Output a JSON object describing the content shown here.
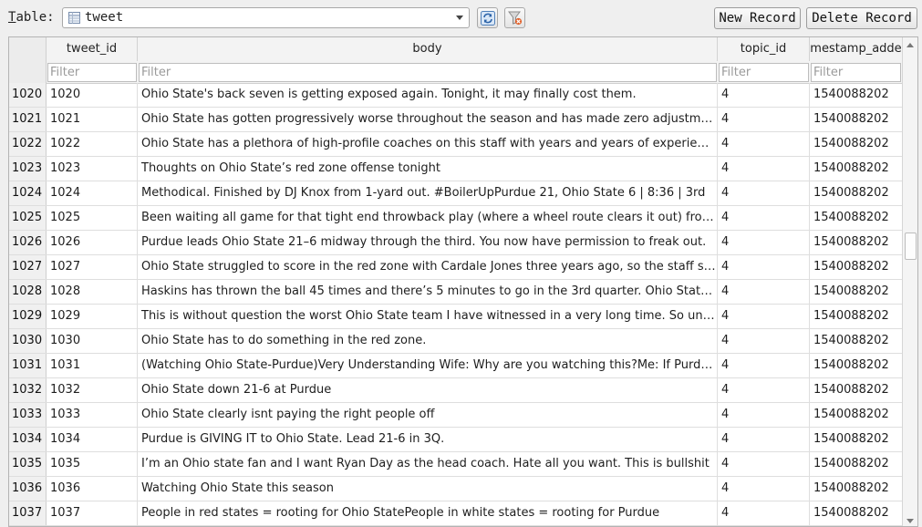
{
  "toolbar": {
    "table_label_prefix": "T",
    "table_label_rest": "able:",
    "table_name": "tweet",
    "table_icon": "table-icon",
    "refresh_icon": "refresh-icon",
    "clear_filter_icon": "clear-filter-icon",
    "new_record_label": "New Record",
    "delete_record_label": "Delete Record"
  },
  "grid": {
    "columns": [
      "tweet_id",
      "body",
      "topic_id",
      "mestamp_adde"
    ],
    "filter_placeholder": "Filter",
    "rows": [
      {
        "rownum": "1020",
        "tweet_id": "1020",
        "body": "Ohio State's back seven is getting exposed again. Tonight, it may finally cost them.",
        "topic_id": "4",
        "timestamp": "1540088202"
      },
      {
        "rownum": "1021",
        "tweet_id": "1021",
        "body": "Ohio State has gotten progressively worse throughout the season and has made zero adjustm…",
        "topic_id": "4",
        "timestamp": "1540088202"
      },
      {
        "rownum": "1022",
        "tweet_id": "1022",
        "body": "Ohio State has a plethora of high-profile coaches on this staff with years and years of experie…",
        "topic_id": "4",
        "timestamp": "1540088202"
      },
      {
        "rownum": "1023",
        "tweet_id": "1023",
        "body": "Thoughts on Ohio State’s red zone offense tonight",
        "topic_id": "4",
        "timestamp": "1540088202"
      },
      {
        "rownum": "1024",
        "tweet_id": "1024",
        "body": "Methodical. Finished by DJ Knox from 1-yard out. #BoilerUpPurdue 21, Ohio State 6 | 8:36 | 3rd",
        "topic_id": "4",
        "timestamp": "1540088202"
      },
      {
        "rownum": "1025",
        "tweet_id": "1025",
        "body": "Been waiting all game for that tight end throwback play (where a wheel route clears it out) fro…",
        "topic_id": "4",
        "timestamp": "1540088202"
      },
      {
        "rownum": "1026",
        "tweet_id": "1026",
        "body": "Purdue leads Ohio State 21–6 midway through the third. You now have permission to freak out.",
        "topic_id": "4",
        "timestamp": "1540088202"
      },
      {
        "rownum": "1027",
        "tweet_id": "1027",
        "body": "Ohio State struggled to score in the red zone with Cardale Jones three years ago, so the staff s…",
        "topic_id": "4",
        "timestamp": "1540088202"
      },
      {
        "rownum": "1028",
        "tweet_id": "1028",
        "body": "Haskins has thrown the ball 45 times and there’s 5 minutes to go in the 3rd quarter. Ohio Stat…",
        "topic_id": "4",
        "timestamp": "1540088202"
      },
      {
        "rownum": "1029",
        "tweet_id": "1029",
        "body": "This is without question the worst Ohio State team I have witnessed in a very long time. So un…",
        "topic_id": "4",
        "timestamp": "1540088202"
      },
      {
        "rownum": "1030",
        "tweet_id": "1030",
        "body": "Ohio State has to do something in the red zone.",
        "topic_id": "4",
        "timestamp": "1540088202"
      },
      {
        "rownum": "1031",
        "tweet_id": "1031",
        "body": "(Watching Ohio State-Purdue)Very Understanding Wife: Why are you watching this?Me: If Purd…",
        "topic_id": "4",
        "timestamp": "1540088202"
      },
      {
        "rownum": "1032",
        "tweet_id": "1032",
        "body": "Ohio State down 21-6 at Purdue",
        "topic_id": "4",
        "timestamp": "1540088202"
      },
      {
        "rownum": "1033",
        "tweet_id": "1033",
        "body": "Ohio State clearly isnt paying the right people off",
        "topic_id": "4",
        "timestamp": "1540088202"
      },
      {
        "rownum": "1034",
        "tweet_id": "1034",
        "body": "Purdue is GIVING IT to Ohio State. Lead 21-6 in 3Q.",
        "topic_id": "4",
        "timestamp": "1540088202"
      },
      {
        "rownum": "1035",
        "tweet_id": "1035",
        "body": "I’m an Ohio state fan and I want Ryan  Day as the head coach. Hate all you want. This is bullshit",
        "topic_id": "4",
        "timestamp": "1540088202"
      },
      {
        "rownum": "1036",
        "tweet_id": "1036",
        "body": "Watching Ohio State this season",
        "topic_id": "4",
        "timestamp": "1540088202"
      },
      {
        "rownum": "1037",
        "tweet_id": "1037",
        "body": "People in red states = rooting for Ohio StatePeople in white states = rooting for Purdue",
        "topic_id": "4",
        "timestamp": "1540088202"
      }
    ]
  }
}
